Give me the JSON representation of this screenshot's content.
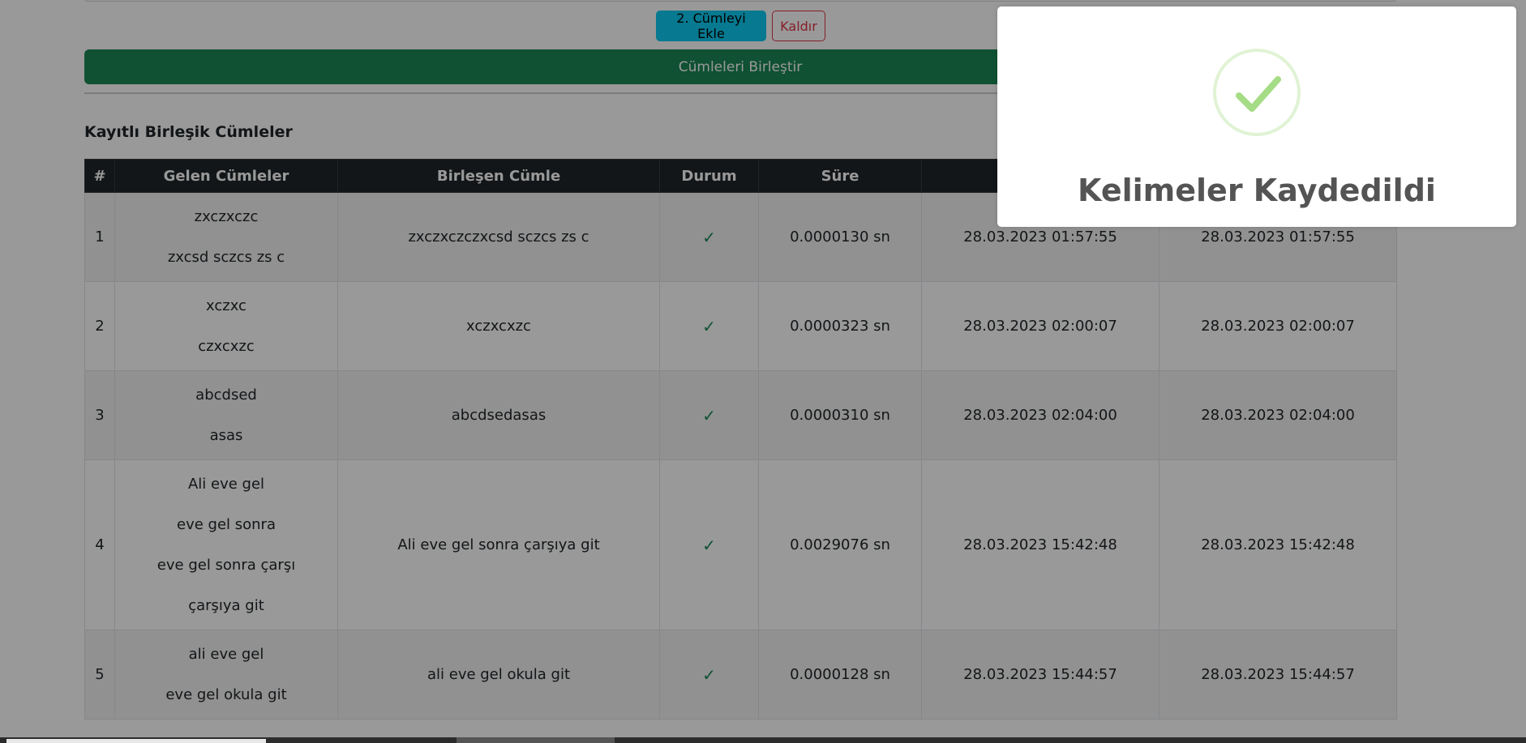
{
  "toolbar": {
    "add_button": "2. Cümleyi Ekle",
    "remove_button": "Kaldır",
    "merge_button": "Cümleleri Birleştir"
  },
  "section": {
    "title": "Kayıtlı Birleşik Cümleler"
  },
  "table": {
    "headers": [
      "#",
      "Gelen Cümleler",
      "Birleşen Cümle",
      "Durum",
      "Süre",
      "",
      ""
    ],
    "rows": [
      {
        "num": "1",
        "inputs": [
          "zxczxczc",
          "zxcsd sczcs zs c"
        ],
        "merged": "zxczxczczxcsd sczcs zs c",
        "status": "✓",
        "duration": "0.0000130 sn",
        "created": "28.03.2023 01:57:55",
        "updated": "28.03.2023 01:57:55"
      },
      {
        "num": "2",
        "inputs": [
          "xczxc",
          "czxcxzc"
        ],
        "merged": "xczxcxzc",
        "status": "✓",
        "duration": "0.0000323 sn",
        "created": "28.03.2023 02:00:07",
        "updated": "28.03.2023 02:00:07"
      },
      {
        "num": "3",
        "inputs": [
          "abcdsed",
          "asas"
        ],
        "merged": "abcdsedasas",
        "status": "✓",
        "duration": "0.0000310 sn",
        "created": "28.03.2023 02:04:00",
        "updated": "28.03.2023 02:04:00"
      },
      {
        "num": "4",
        "inputs": [
          "Ali eve gel",
          "eve gel sonra",
          "eve gel sonra çarşı",
          "çarşıya git"
        ],
        "merged": "Ali eve gel sonra çarşıya git",
        "status": "✓",
        "duration": "0.0029076 sn",
        "created": "28.03.2023 15:42:48",
        "updated": "28.03.2023 15:42:48"
      },
      {
        "num": "5",
        "inputs": [
          "ali eve gel",
          "eve gel okula git"
        ],
        "merged": "ali eve gel okula git",
        "status": "✓",
        "duration": "0.0000128 sn",
        "created": "28.03.2023 15:44:57",
        "updated": "28.03.2023 15:44:57"
      }
    ]
  },
  "toast": {
    "icon": "success-check-icon",
    "title": "Kelimeler Kaydedildi"
  },
  "colors": {
    "info_button": "#0dcaf0",
    "danger": "#dc3545",
    "success": "#198754",
    "table_header": "#212529",
    "success_icon": "#a5dc86"
  }
}
